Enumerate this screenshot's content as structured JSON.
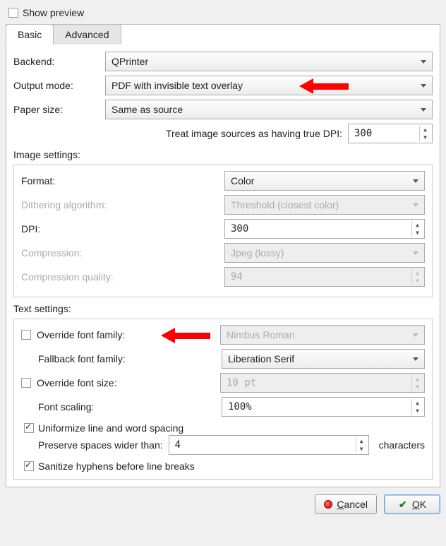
{
  "show_preview": {
    "label": "Show preview",
    "checked": false
  },
  "tabs": {
    "basic": "Basic",
    "advanced": "Advanced",
    "active": "basic"
  },
  "backend": {
    "label": "Backend:",
    "value": "QPrinter"
  },
  "output_mode": {
    "label": "Output mode:",
    "value": "PDF with invisible text overlay"
  },
  "paper_size": {
    "label": "Paper size:",
    "value": "Same as source"
  },
  "true_dpi": {
    "label": "Treat image sources as having true DPI:",
    "value": "300"
  },
  "image_settings": {
    "title": "Image settings:",
    "format": {
      "label": "Format:",
      "value": "Color"
    },
    "dithering": {
      "label": "Dithering algorithm:",
      "value": "Threshold (closest color)"
    },
    "dpi": {
      "label": "DPI:",
      "value": "300"
    },
    "compression": {
      "label": "Compression:",
      "value": "Jpeg (lossy)"
    },
    "compression_quality": {
      "label": "Compression quality:",
      "value": "94"
    }
  },
  "text_settings": {
    "title": "Text settings:",
    "override_font_family": {
      "label": "Override font family:",
      "checked": false,
      "value": "Nimbus Roman"
    },
    "fallback_font_family": {
      "label": "Fallback font family:",
      "value": "Liberation Serif"
    },
    "override_font_size": {
      "label": "Override font size:",
      "checked": false,
      "value": "10 pt"
    },
    "font_scaling": {
      "label": "Font scaling:",
      "value": "100%"
    },
    "uniformize": {
      "label": "Uniformize line and word spacing",
      "checked": true
    },
    "preserve_spaces": {
      "label": "Preserve spaces wider than:",
      "value": "4",
      "suffix": "characters"
    },
    "sanitize_hyphens": {
      "label": "Sanitize hyphens before line breaks",
      "checked": true
    }
  },
  "buttons": {
    "cancel": "Cancel",
    "ok": "OK"
  }
}
